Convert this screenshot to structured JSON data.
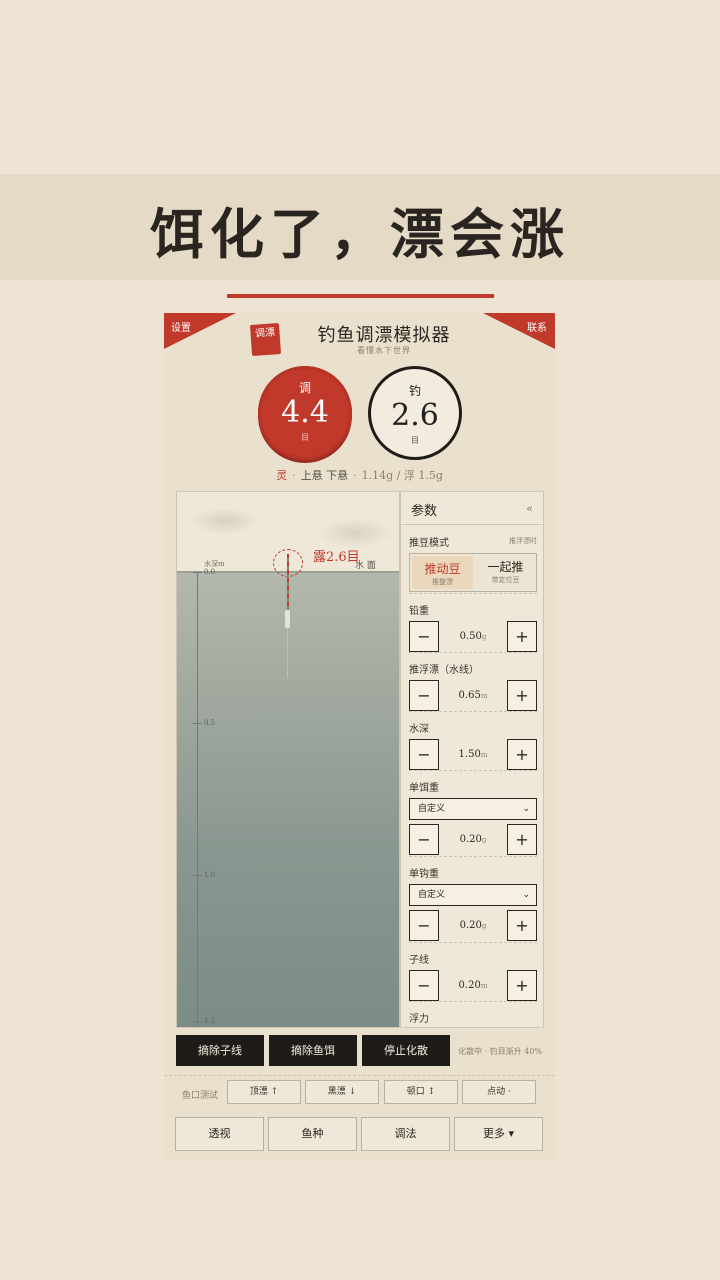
{
  "promo": {
    "headline": "饵化了，漂会涨"
  },
  "app": {
    "corner_left": "设置",
    "corner_right": "联系",
    "seal": "调漂",
    "title": "钓鱼调漂模拟器",
    "subtitle": "看懂水下世界"
  },
  "dials": {
    "tiao": {
      "label": "调",
      "value": "4.4",
      "unit": "目"
    },
    "diao": {
      "label": "钓",
      "value": "2.6",
      "unit": "目"
    }
  },
  "summary": {
    "sensitivity": "灵",
    "suspension": "上悬 下悬",
    "weights": "1.14g / 浮 1.5g"
  },
  "viewport": {
    "depth_header": "水深m",
    "surface_label": "水 面",
    "exposed_label": "露2.6目",
    "ticks": [
      "0.0",
      "0.5",
      "1.0",
      "1.5"
    ]
  },
  "panel": {
    "title": "参数",
    "collapse": "«",
    "push_mode": {
      "label": "推豆模式",
      "hint": "推浮漂时",
      "option_a": "推动豆",
      "option_a_sub": "推整漂",
      "option_b": "一起推",
      "option_b_sub": "带定位豆"
    },
    "sinker": {
      "label": "铅重",
      "value": "0.50",
      "unit": "g"
    },
    "push_float": {
      "label": "推浮漂（水线）",
      "value": "0.65",
      "unit": "m"
    },
    "depth": {
      "label": "水深",
      "value": "1.50",
      "unit": "m"
    },
    "bait": {
      "label": "单饵重",
      "select": "自定义",
      "value": "0.20",
      "unit": "g"
    },
    "hook": {
      "label": "单钩重",
      "select": "自定义",
      "value": "0.20",
      "unit": "g"
    },
    "leader": {
      "label": "子线",
      "value": "0.20",
      "unit": "m"
    },
    "buoyancy": {
      "label": "浮力"
    },
    "minus": "−",
    "plus": "+"
  },
  "actions": {
    "remove_leader": "摘除子线",
    "remove_bait": "摘除鱼饵",
    "stop_dissolve": "停止化散",
    "status": "化散中 · 钓目渐升 40%"
  },
  "fish_test": {
    "label": "鱼口测试",
    "b1": "顶漂 ↑",
    "b2": "黑漂 ↓",
    "b3": "顿口 ↕",
    "b4": "点动 ·"
  },
  "nav": {
    "b1": "透视",
    "b2": "鱼种",
    "b3": "调法",
    "b4": "更多 ▾"
  },
  "colors": {
    "accent": "#c0392b",
    "background": "#ede4d3",
    "dark": "#1e1b18"
  }
}
